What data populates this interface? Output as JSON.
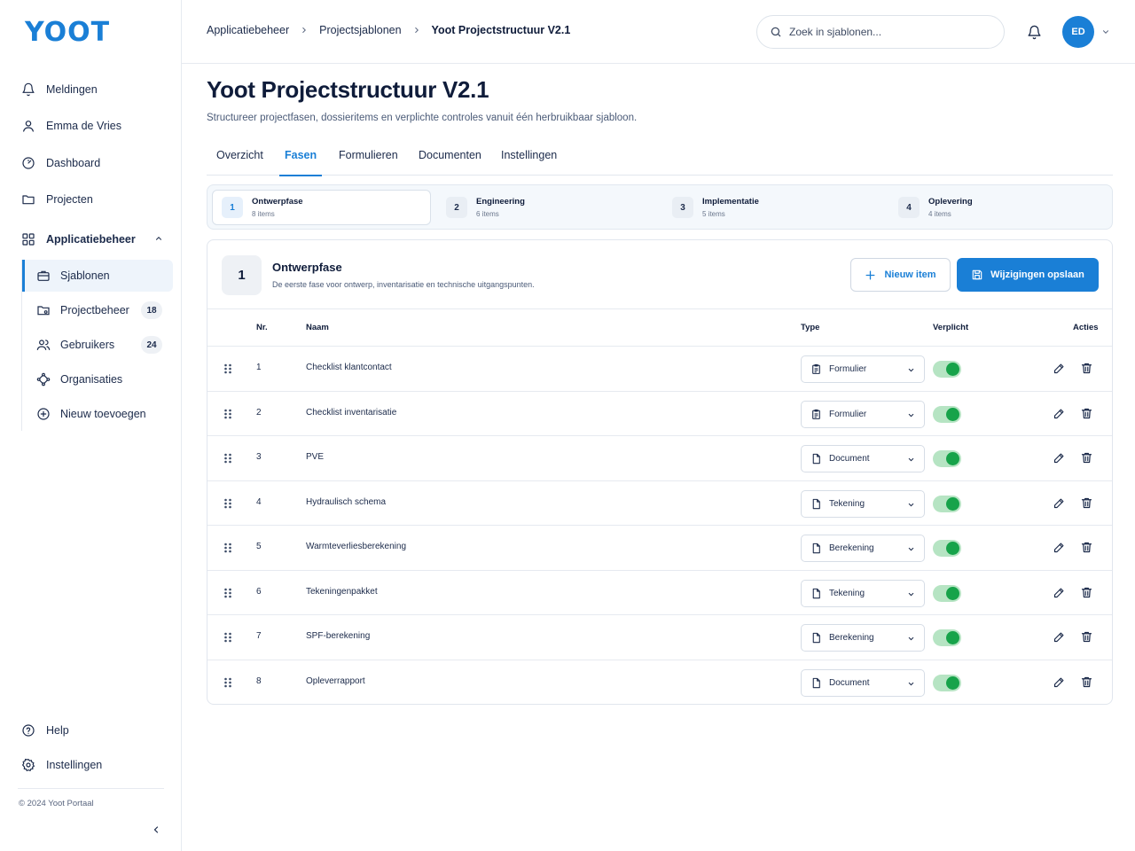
{
  "app": {
    "logo": "YOOT"
  },
  "sidebar": {
    "items": [
      {
        "label": "Meldingen",
        "icon": "bell-icon"
      },
      {
        "label": "Emma de Vries",
        "icon": "user-icon"
      },
      {
        "label": "Dashboard",
        "icon": "gauge-icon"
      },
      {
        "label": "Projecten",
        "icon": "folder-icon"
      }
    ],
    "section": {
      "label": "Applicatiebeheer",
      "icon": "grid-icon",
      "expanded": true
    },
    "sub_items": [
      {
        "label": "Sjablonen",
        "icon": "briefcase-icon",
        "active": true
      },
      {
        "label": "Projectbeheer",
        "icon": "folder-settings-icon",
        "count": "18"
      },
      {
        "label": "Gebruikers",
        "icon": "users-icon",
        "count": "24"
      },
      {
        "label": "Organisaties",
        "icon": "network-icon"
      },
      {
        "label": "Nieuw toevoegen",
        "icon": "plus-circle-icon"
      }
    ],
    "footer_items": [
      {
        "label": "Help",
        "icon": "help-circle-icon"
      },
      {
        "label": "Instellingen",
        "icon": "gear-icon"
      }
    ],
    "copyright": "© 2024 Yoot Portaal"
  },
  "header": {
    "breadcrumb": [
      "Applicatiebeheer",
      "Projectsjablonen",
      "Yoot Projectstructuur V2.1"
    ],
    "search_placeholder": "Zoek in sjablonen...",
    "avatar_initials": "ED"
  },
  "page": {
    "title": "Yoot Projectstructuur V2.1",
    "subtitle": "Structureer projectfasen, dossieritems en verplichte controles vanuit één herbruikbaar sjabloon."
  },
  "tabs": [
    {
      "label": "Overzicht",
      "active": false
    },
    {
      "label": "Fasen",
      "active": true
    },
    {
      "label": "Formulieren",
      "active": false
    },
    {
      "label": "Documenten",
      "active": false
    },
    {
      "label": "Instellingen",
      "active": false
    }
  ],
  "phases": [
    {
      "num": "1",
      "title": "Ontwerpfase",
      "sub": "8 items",
      "active": true
    },
    {
      "num": "2",
      "title": "Engineering",
      "sub": "6 items",
      "active": false
    },
    {
      "num": "3",
      "title": "Implementatie",
      "sub": "5 items",
      "active": false
    },
    {
      "num": "4",
      "title": "Oplevering",
      "sub": "4 items",
      "active": false
    }
  ],
  "phase_detail": {
    "num": "1",
    "title": "Ontwerpfase",
    "description": "De eerste fase voor ontwerp, inventarisatie en technische uitgangspunten.",
    "new_button": "Nieuw item",
    "save_button": "Wijzigingen opslaan"
  },
  "table": {
    "columns": {
      "nr": "Nr.",
      "name": "Naam",
      "type": "Type",
      "required": "Verplicht",
      "actions": "Acties"
    },
    "rows": [
      {
        "nr": "1",
        "name": "Checklist klantcontact",
        "type": "Formulier",
        "type_icon": "clipboard-icon",
        "required": true
      },
      {
        "nr": "2",
        "name": "Checklist inventarisatie",
        "type": "Formulier",
        "type_icon": "clipboard-icon",
        "required": true
      },
      {
        "nr": "3",
        "name": "PVE",
        "type": "Document",
        "type_icon": "file-icon",
        "required": true
      },
      {
        "nr": "4",
        "name": "Hydraulisch schema",
        "type": "Tekening",
        "type_icon": "file-icon",
        "required": true
      },
      {
        "nr": "5",
        "name": "Warmteverliesberekening",
        "type": "Berekening",
        "type_icon": "file-icon",
        "required": true
      },
      {
        "nr": "6",
        "name": "Tekeningenpakket",
        "type": "Tekening",
        "type_icon": "file-icon",
        "required": true
      },
      {
        "nr": "7",
        "name": "SPF-berekening",
        "type": "Berekening",
        "type_icon": "file-icon",
        "required": true
      },
      {
        "nr": "8",
        "name": "Opleverrapport",
        "type": "Document",
        "type_icon": "file-icon",
        "required": true
      }
    ]
  },
  "colors": {
    "accent": "#1a7fd6",
    "toggle_on": "#17a34a",
    "toggle_track": "#b6e4c3",
    "text": "#0f1c3a"
  }
}
